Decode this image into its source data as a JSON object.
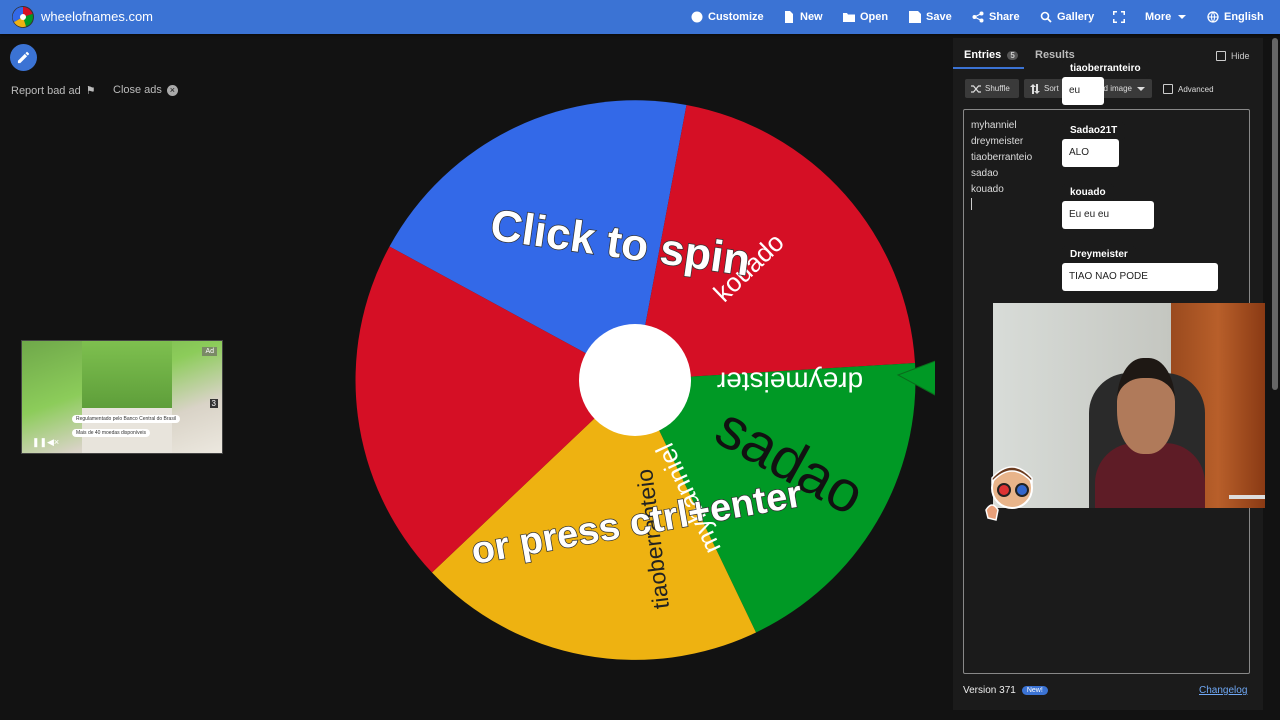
{
  "topbar": {
    "site_title": "wheelofnames.com",
    "nav": {
      "customize": "Customize",
      "new": "New",
      "open": "Open",
      "save": "Save",
      "share": "Share",
      "gallery": "Gallery",
      "more": "More",
      "language": "English"
    }
  },
  "ads": {
    "report": "Report bad ad",
    "close": "Close ads",
    "ad_tag": "Ad",
    "ad_line_1": "Regulamentado pelo Banco Central do Brasil",
    "ad_line_2": "Mais de 40 moedas disponíveis",
    "counter": "3"
  },
  "wheel": {
    "entries": [
      "myhanniel",
      "dreymeister",
      "tiaoberranteio",
      "sadao",
      "kouado"
    ],
    "click_text": "Click to spin",
    "press_text": "or press ctrl+enter",
    "colors": {
      "blue": "#3369e8",
      "red": "#d50f25",
      "green": "#009925",
      "yellow": "#eeb211",
      "pointer": "#009925",
      "hub": "#ffffff"
    }
  },
  "panel": {
    "tab_entries": "Entries",
    "entries_count": "5",
    "tab_results": "Results",
    "hide": "Hide",
    "shuffle": "Shuffle",
    "sort": "Sort",
    "add_image": "d image",
    "advanced": "Advanced",
    "entries_text": [
      "myhanniel",
      "dreymeister",
      "tiaoberranteio",
      "sadao",
      "kouado"
    ],
    "version": "Version 371",
    "new_badge": "New!",
    "changelog": "Changelog"
  },
  "chat": [
    {
      "user": "tiaoberranteiro",
      "message": "eu"
    },
    {
      "user": "Sadao21T",
      "message": "ALO"
    },
    {
      "user": "kouado",
      "message": "Eu eu eu"
    },
    {
      "user": "Dreymeister",
      "message": "TIAO NAO PODE"
    }
  ]
}
